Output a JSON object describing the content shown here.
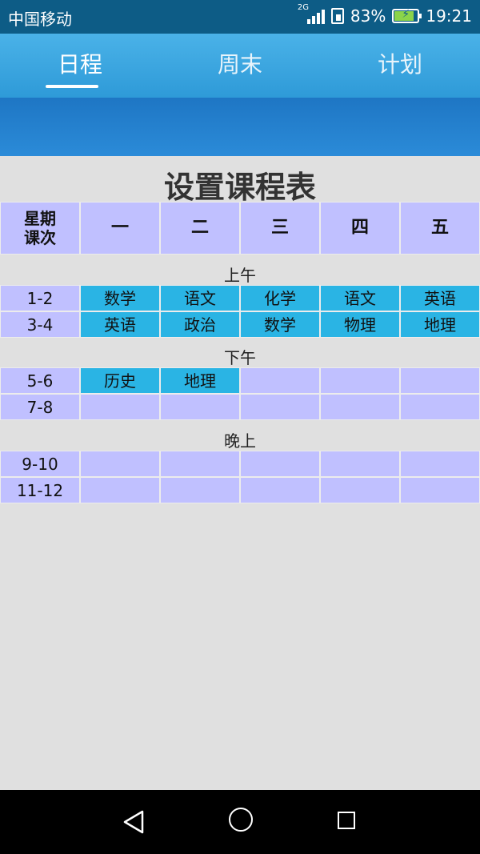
{
  "status_bar": {
    "carrier": "中国移动",
    "network": "2G",
    "battery": "83%",
    "time": "19:21"
  },
  "tabs": [
    {
      "label": "日程",
      "active": true
    },
    {
      "label": "周末",
      "active": false
    },
    {
      "label": "计划",
      "active": false
    }
  ],
  "title": "设置课程表",
  "header": {
    "corner": "星期\n课次",
    "days": [
      "一",
      "二",
      "三",
      "四",
      "五"
    ]
  },
  "sections": [
    {
      "label": "上午",
      "rows": [
        {
          "period": "1-2",
          "cells": [
            "数学",
            "语文",
            "化学",
            "语文",
            "英语"
          ]
        },
        {
          "period": "3-4",
          "cells": [
            "英语",
            "政治",
            "数学",
            "物理",
            "地理"
          ]
        }
      ]
    },
    {
      "label": "下午",
      "rows": [
        {
          "period": "5-6",
          "cells": [
            "历史",
            "地理",
            "",
            "",
            ""
          ]
        },
        {
          "period": "7-8",
          "cells": [
            "",
            "",
            "",
            "",
            ""
          ]
        }
      ]
    },
    {
      "label": "晚上",
      "rows": [
        {
          "period": "9-10",
          "cells": [
            "",
            "",
            "",
            "",
            ""
          ]
        },
        {
          "period": "11-12",
          "cells": [
            "",
            "",
            "",
            "",
            ""
          ]
        }
      ]
    }
  ],
  "colors": {
    "filled_cell": "#2ab4e4",
    "empty_cell": "#c0c0ff",
    "tab_bar": "#3aa6e0"
  }
}
